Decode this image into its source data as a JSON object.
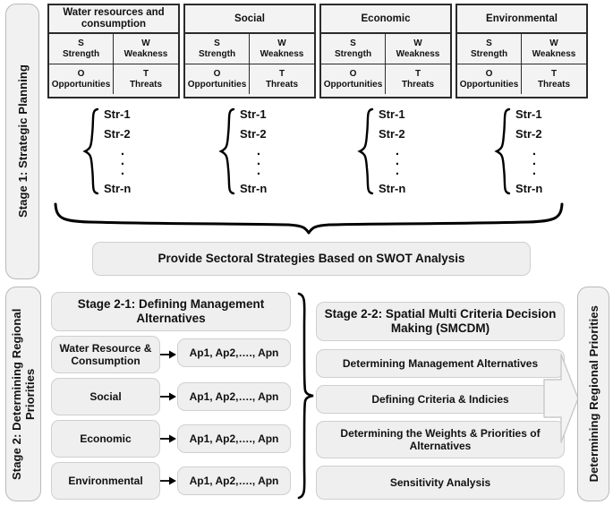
{
  "stages": {
    "stage1_label": "Stage 1: Strategic Planning",
    "stage2_label": "Stage 2: Determining Regional Priorities",
    "outcome_label": "Determining Regional Priorities"
  },
  "swot": {
    "cells": [
      {
        "letter": "S",
        "word": "Strength"
      },
      {
        "letter": "W",
        "word": "Weakness"
      },
      {
        "letter": "O",
        "word": "Opportunities"
      },
      {
        "letter": "T",
        "word": "Threats"
      }
    ],
    "sectors": [
      {
        "title": "Water resources and consumption"
      },
      {
        "title": "Social"
      },
      {
        "title": "Economic"
      },
      {
        "title": "Environmental"
      }
    ]
  },
  "strategies": {
    "first": "Str-1",
    "second": "Str-2",
    "last": "Str-n",
    "groups": [
      "water",
      "social",
      "economic",
      "environmental"
    ]
  },
  "sectoral_strategies_box": "Provide Sectoral Strategies Based on SWOT Analysis",
  "stage21": {
    "title": "Stage 2-1: Defining Management Alternatives",
    "rows": [
      {
        "sector": "Water Resource & Consumption",
        "alternatives": "Ap1, Ap2,…., Apn"
      },
      {
        "sector": "Social",
        "alternatives": "Ap1, Ap2,…., Apn"
      },
      {
        "sector": "Economic",
        "alternatives": "Ap1, Ap2,…., Apn"
      },
      {
        "sector": "Environmental",
        "alternatives": "Ap1, Ap2,…., Apn"
      }
    ]
  },
  "stage22": {
    "title": "Stage 2-2: Spatial Multi Criteria Decision Making (SMCDM)",
    "steps": [
      "Determining Management Alternatives",
      "Defining Criteria & Indicies",
      "Determining the Weights & Priorities of Alternatives",
      "Sensitivity Analysis"
    ]
  },
  "colors": {
    "box_fill": "#efefef",
    "box_border": "#cfcfcf",
    "table_border": "#2b2b2b",
    "table_fill": "#f3f3f3",
    "bar_fill": "#f1f1f1",
    "line": "#000000"
  }
}
